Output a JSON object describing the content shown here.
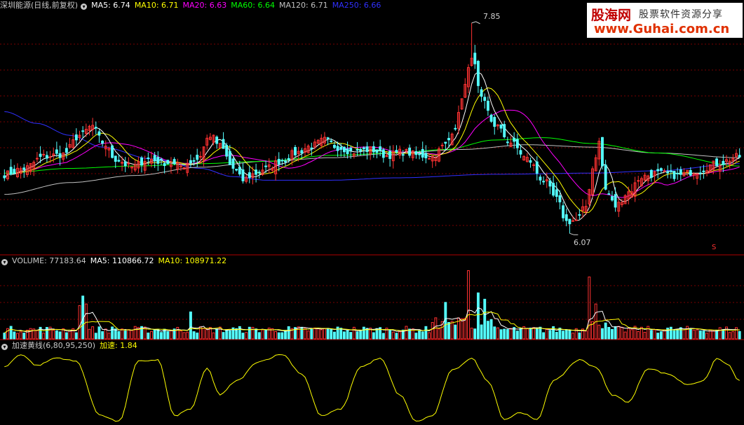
{
  "main_panel": {
    "stock_name": "深圳能源(日线,前复权)",
    "ma_labels": [
      {
        "label": "MA5: 6.74",
        "color": "#ffffff"
      },
      {
        "label": "MA10: 6.71",
        "color": "#ffff00"
      },
      {
        "label": "MA20: 6.63",
        "color": "#ff00ff"
      },
      {
        "label": "MA60: 6.64",
        "color": "#00ff00"
      },
      {
        "label": "MA120: 6.71",
        "color": "#c0c0c0"
      },
      {
        "label": "MA250: 6.66",
        "color": "#3030ff"
      }
    ],
    "high_label": "7.85",
    "low_label": "6.07",
    "marker_label": "S"
  },
  "volume_panel": {
    "labels": [
      {
        "label": "VOLUME: 77183.64",
        "color": "#c8c8c8"
      },
      {
        "label": "MA5: 110866.72",
        "color": "#ffffff"
      },
      {
        "label": "MA10: 108971.22",
        "color": "#ffff00"
      }
    ]
  },
  "indicator_panel": {
    "labels": [
      {
        "label": "加速黄线(6,80,95,250)",
        "color": "#c8c8c8"
      },
      {
        "label": "加速: 1.84",
        "color": "#ffff00"
      }
    ]
  },
  "watermark": {
    "line1_brand": "股海网",
    "line1_text": "股票软件资源分享",
    "line2": "www.Guhai.com.cn"
  },
  "chart_data": {
    "type": "candlestick",
    "price_range": [
      5.9,
      7.95
    ],
    "high": 7.85,
    "low": 6.07,
    "colors": {
      "up": "#ff3232",
      "down": "#54ffff",
      "grid": "#7a0000",
      "ma5": "#ffffff",
      "ma10": "#ffff00",
      "ma20": "#ff00ff",
      "ma60": "#00ff00",
      "ma120": "#c0c0c0",
      "ma250": "#3030ff",
      "indicator": "#ffff00"
    },
    "last_values": {
      "close_ma5": 6.74,
      "ma10": 6.71,
      "ma20": 6.63,
      "ma60": 6.64,
      "ma120": 6.71,
      "ma250": 6.66,
      "volume": 77183.64,
      "vol_ma5": 110866.72,
      "vol_ma10": 108971.22,
      "accel": 1.84
    },
    "close_anchors": [
      [
        0,
        6.57
      ],
      [
        6,
        6.62
      ],
      [
        12,
        6.72
      ],
      [
        18,
        6.74
      ],
      [
        23,
        6.9
      ],
      [
        27,
        6.98
      ],
      [
        30,
        6.84
      ],
      [
        34,
        6.7
      ],
      [
        39,
        6.63
      ],
      [
        44,
        6.7
      ],
      [
        49,
        6.67
      ],
      [
        54,
        6.64
      ],
      [
        59,
        6.7
      ],
      [
        63,
        6.9
      ],
      [
        66,
        6.81
      ],
      [
        70,
        6.62
      ],
      [
        73,
        6.52
      ],
      [
        76,
        6.57
      ],
      [
        80,
        6.62
      ],
      [
        85,
        6.69
      ],
      [
        89,
        6.75
      ],
      [
        94,
        6.81
      ],
      [
        98,
        6.86
      ],
      [
        102,
        6.8
      ],
      [
        107,
        6.76
      ],
      [
        112,
        6.78
      ],
      [
        117,
        6.73
      ],
      [
        122,
        6.76
      ],
      [
        127,
        6.73
      ],
      [
        131,
        6.72
      ],
      [
        135,
        6.82
      ],
      [
        138,
        6.98
      ],
      [
        141,
        7.32
      ],
      [
        143,
        7.58
      ],
      [
        146,
        7.2
      ],
      [
        150,
        6.99
      ],
      [
        155,
        6.84
      ],
      [
        160,
        6.7
      ],
      [
        165,
        6.52
      ],
      [
        169,
        6.36
      ],
      [
        172,
        6.17
      ],
      [
        175,
        6.18
      ],
      [
        178,
        6.3
      ],
      [
        180,
        6.62
      ],
      [
        182,
        6.84
      ],
      [
        184,
        6.44
      ],
      [
        187,
        6.3
      ],
      [
        191,
        6.42
      ],
      [
        195,
        6.55
      ],
      [
        200,
        6.58
      ],
      [
        206,
        6.56
      ],
      [
        212,
        6.6
      ],
      [
        218,
        6.66
      ],
      [
        225,
        6.72
      ]
    ],
    "ma250_anchors": [
      [
        0,
        7.1
      ],
      [
        10,
        7.0
      ],
      [
        20,
        6.9
      ],
      [
        30,
        6.8
      ],
      [
        45,
        6.7
      ],
      [
        60,
        6.62
      ],
      [
        70,
        6.55
      ],
      [
        80,
        6.52
      ],
      [
        100,
        6.52
      ],
      [
        120,
        6.54
      ],
      [
        150,
        6.57
      ],
      [
        180,
        6.58
      ],
      [
        200,
        6.6
      ],
      [
        225,
        6.66
      ]
    ],
    "ma120_anchors": [
      [
        0,
        6.4
      ],
      [
        20,
        6.5
      ],
      [
        40,
        6.56
      ],
      [
        60,
        6.63
      ],
      [
        80,
        6.68
      ],
      [
        100,
        6.71
      ],
      [
        120,
        6.75
      ],
      [
        140,
        6.78
      ],
      [
        160,
        6.82
      ],
      [
        180,
        6.8
      ],
      [
        200,
        6.75
      ],
      [
        225,
        6.71
      ]
    ],
    "ma60_anchors": [
      [
        0,
        6.58
      ],
      [
        20,
        6.62
      ],
      [
        40,
        6.64
      ],
      [
        60,
        6.66
      ],
      [
        80,
        6.68
      ],
      [
        100,
        6.73
      ],
      [
        120,
        6.75
      ],
      [
        135,
        6.78
      ],
      [
        150,
        6.86
      ],
      [
        165,
        6.88
      ],
      [
        180,
        6.83
      ],
      [
        200,
        6.75
      ],
      [
        225,
        6.64
      ]
    ],
    "volume_spikes": [
      [
        23,
        2.1
      ],
      [
        24,
        2.7
      ],
      [
        25,
        2.2
      ],
      [
        57,
        1.7
      ],
      [
        135,
        2.3
      ],
      [
        142,
        4.3
      ],
      [
        145,
        2.9
      ],
      [
        147,
        2.5
      ],
      [
        179,
        3.9
      ],
      [
        181,
        2.2
      ]
    ],
    "indicator_anchors": [
      [
        0,
        0.8
      ],
      [
        5,
        0.98
      ],
      [
        10,
        0.82
      ],
      [
        16,
        0.93
      ],
      [
        22,
        0.88
      ],
      [
        29,
        0.12
      ],
      [
        35,
        0.02
      ],
      [
        41,
        0.88
      ],
      [
        47,
        0.9
      ],
      [
        52,
        0.1
      ],
      [
        57,
        0.2
      ],
      [
        62,
        0.78
      ],
      [
        66,
        0.4
      ],
      [
        71,
        0.6
      ],
      [
        78,
        0.88
      ],
      [
        85,
        0.98
      ],
      [
        91,
        0.7
      ],
      [
        97,
        0.1
      ],
      [
        103,
        0.2
      ],
      [
        109,
        0.8
      ],
      [
        115,
        0.92
      ],
      [
        121,
        0.4
      ],
      [
        126,
        0.02
      ],
      [
        131,
        0.1
      ],
      [
        137,
        0.75
      ],
      [
        143,
        0.92
      ],
      [
        148,
        0.6
      ],
      [
        153,
        0.05
      ],
      [
        158,
        0.15
      ],
      [
        163,
        0.04
      ],
      [
        168,
        0.6
      ],
      [
        176,
        0.9
      ],
      [
        181,
        0.8
      ],
      [
        186,
        0.4
      ],
      [
        191,
        0.3
      ],
      [
        197,
        0.78
      ],
      [
        203,
        0.7
      ],
      [
        209,
        0.55
      ],
      [
        214,
        0.6
      ],
      [
        218,
        0.92
      ],
      [
        221,
        0.85
      ],
      [
        225,
        0.6
      ]
    ]
  }
}
